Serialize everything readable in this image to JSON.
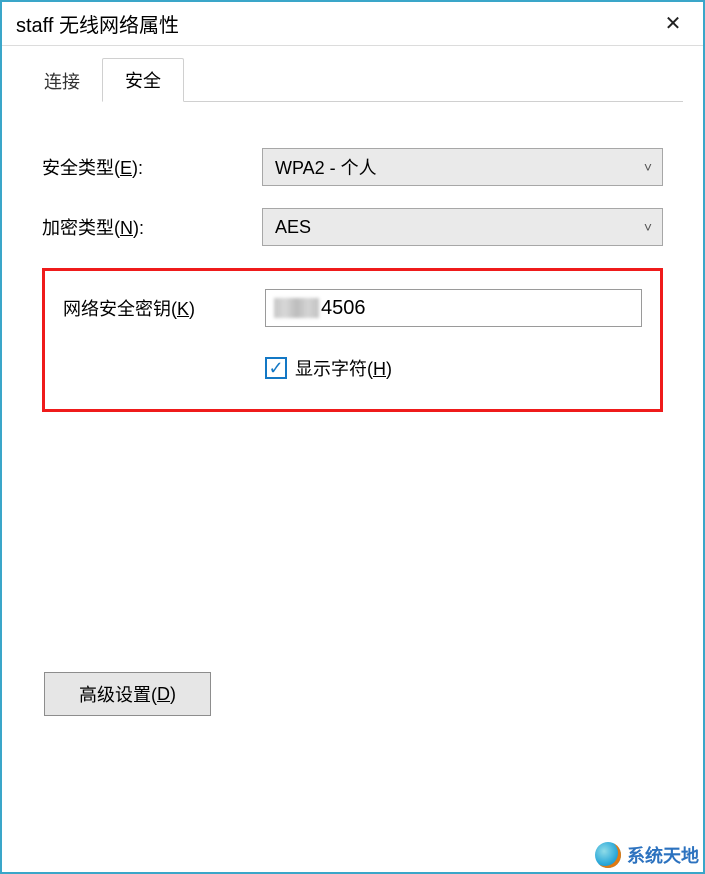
{
  "window": {
    "title": "staff 无线网络属性",
    "close_glyph": "✕"
  },
  "tabs": {
    "connection": "连接",
    "security": "安全"
  },
  "form": {
    "security_type_prefix": "安全类型(",
    "security_type_hotkey": "E",
    "security_type_suffix": "):",
    "security_type_value": "WPA2 - 个人",
    "encryption_type_prefix": "加密类型(",
    "encryption_type_hotkey": "N",
    "encryption_type_suffix": "):",
    "encryption_type_value": "AES",
    "network_key_prefix": "网络安全密钥(",
    "network_key_hotkey": "K",
    "network_key_suffix": ")",
    "network_key_value_visible": "4506",
    "show_chars_prefix": "显示字符(",
    "show_chars_hotkey": "H",
    "show_chars_suffix": ")",
    "show_chars_checked": true,
    "check_glyph": "✓",
    "chevron": "˅"
  },
  "advanced": {
    "label_prefix": "高级设置(",
    "label_hotkey": "D",
    "label_suffix": ")"
  },
  "watermark": {
    "text": "系统天地"
  }
}
